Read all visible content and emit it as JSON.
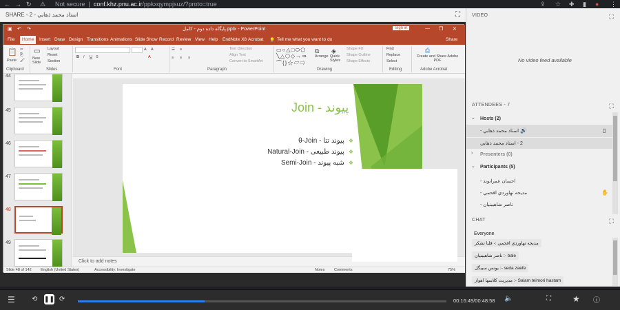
{
  "browser": {
    "security": "Not secure",
    "domain": "conf.khz.pnu.ac.ir",
    "path": "/ppkxqympjsuz/?proto=true"
  },
  "share": {
    "title": "SHARE - 2 - استاد محمد ذهابي"
  },
  "ppt": {
    "filename": "پایگاه داده دوم - کامل.pptx - PowerPoint",
    "signin": "Sign in",
    "tabs": [
      "File",
      "Home",
      "Insert",
      "Draw",
      "Design",
      "Transitions",
      "Animations",
      "Slide Show",
      "Record",
      "Review",
      "View",
      "Help",
      "EndNote X8",
      "Acrobat"
    ],
    "tell_me": "Tell me what you want to do",
    "share": "Share",
    "ribbon": {
      "paste": "Paste",
      "new_slide": "New Slide",
      "layout": "Layout",
      "reset": "Reset",
      "section": "Section",
      "text_direction": "Text Direction",
      "align_text": "Align Text",
      "convert_smartart": "Convert to SmartArt",
      "arrange": "Arrange",
      "quick_styles": "Quick Styles",
      "shape_fill": "Shape Fill",
      "shape_outline": "Shape Outline",
      "shape_effects": "Shape Effects",
      "find": "Find",
      "replace": "Replace",
      "select": "Select",
      "create_share": "Create and Share Adobe PDF",
      "groups": {
        "clipboard": "Clipboard",
        "slides": "Slides",
        "font": "Font",
        "paragraph": "Paragraph",
        "drawing": "Drawing",
        "editing": "Editing",
        "adobe": "Adobe Acrobat"
      }
    },
    "thumb_numbers": [
      "44",
      "45",
      "46",
      "47",
      "48",
      "49"
    ],
    "slide": {
      "title": "پیوند - Join",
      "bullets": [
        "پیوند تتا - θ-Join",
        "پیوند طبیعی - Natural-Join",
        "شبه پیوند - Semi-Join"
      ]
    },
    "notes_placeholder": "Click to add notes",
    "status": {
      "slide": "Slide 48 of 142",
      "language": "English (United States)",
      "accessibility": "Accessibility: Investigate",
      "notes": "Notes",
      "comments": "Comments",
      "zoom": "75%"
    }
  },
  "video": {
    "header": "VIDEO",
    "message": "No video feed available"
  },
  "attendees": {
    "header": "ATTENDEES - 7",
    "hosts_label": "Hosts (2)",
    "hosts": [
      "استاد محمد ذهابي -",
      "2 - استاد محمد ذهابي"
    ],
    "presenters_label": "Presenters (0)",
    "participants_label": "Participants (5)",
    "participants": [
      "احسان عمرانوند -",
      "مدیحه تهاوردي اقحمي -",
      "ناصر شاهيبنيان -"
    ]
  },
  "chat": {
    "header": "CHAT",
    "recipient": "Everyone",
    "messages": [
      "مدیحه تهاوردي اقحمي :- قلبا تشکر",
      "ناصر شاهيبنيان :- bale",
      "يونس سيبگل :- seda zaefe",
      "مدیریت کلاسها اهواز :- Salam teimori hastam"
    ]
  },
  "player": {
    "time": "00:16:49/00:48:58",
    "progress": 0.3435
  }
}
